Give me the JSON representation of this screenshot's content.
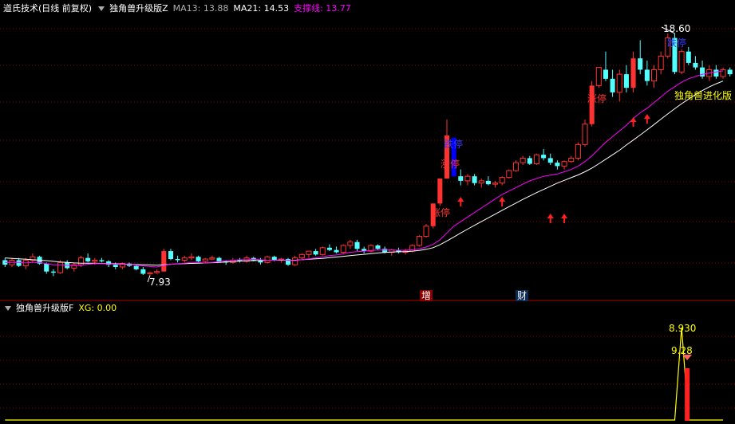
{
  "main_panel": {
    "stock_name": "道氏技术",
    "period": "(日线 前复权)",
    "indicator_name": "独角兽升级版Z",
    "ma13_label": "MA13: 13.88",
    "ma21_label": "MA21: 14.53",
    "support_label": "支撑线: 13.77",
    "high_label": "18.60",
    "low_label": "7.93",
    "annotation_limit_up_1": "涨停",
    "annotation_limit_up_2": "涨停",
    "annotation_limit_up_3": "涨停",
    "annotation_limit_down_1": "跌停",
    "annotation_limit_down_2": "跌停",
    "annotation_evolution": "独角兽进化版",
    "event_increase": "增",
    "event_finance": "财"
  },
  "sub_panel": {
    "indicator_name": "独角兽升级版F",
    "xg_label": "XG: 0.00",
    "peak_label": "8.930",
    "second_label": "9.28"
  },
  "colors": {
    "up": "#ff3232",
    "down": "#54ffff",
    "limit_down": "#0000ff",
    "ma13": "#ff00ff",
    "ma21": "#ffffff",
    "support": "#ffff00",
    "grid": "#8b0000",
    "xg_line": "#ffff00"
  },
  "chart_data": [
    {
      "type": "candlestick",
      "title": "道氏技术 (日线 前复权)",
      "series_labels": [
        "MA13",
        "MA21",
        "支撑线"
      ],
      "ylim": [
        7,
        19.3
      ],
      "candles": [
        [
          8.6,
          8.7,
          8.3,
          8.4
        ],
        [
          8.4,
          8.7,
          8.3,
          8.6
        ],
        [
          8.6,
          8.7,
          8.3,
          8.35
        ],
        [
          8.35,
          8.7,
          8.2,
          8.6
        ],
        [
          8.6,
          8.9,
          8.5,
          8.75
        ],
        [
          8.75,
          8.8,
          8.4,
          8.45
        ],
        [
          8.45,
          8.5,
          8.0,
          8.1
        ],
        [
          8.1,
          8.2,
          7.9,
          8.05
        ],
        [
          8.05,
          8.6,
          8.0,
          8.5
        ],
        [
          8.5,
          8.6,
          8.2,
          8.25
        ],
        [
          8.25,
          8.5,
          8.1,
          8.4
        ],
        [
          8.4,
          8.8,
          8.3,
          8.7
        ],
        [
          8.7,
          8.9,
          8.5,
          8.55
        ],
        [
          8.55,
          8.7,
          8.4,
          8.6
        ],
        [
          8.6,
          8.7,
          8.5,
          8.55
        ],
        [
          8.55,
          8.6,
          8.3,
          8.4
        ],
        [
          8.4,
          8.5,
          8.2,
          8.3
        ],
        [
          8.3,
          8.5,
          8.2,
          8.45
        ],
        [
          8.45,
          8.5,
          8.3,
          8.35
        ],
        [
          8.35,
          8.4,
          8.15,
          8.2
        ],
        [
          8.2,
          8.3,
          7.95,
          8.0
        ],
        [
          8.0,
          8.1,
          7.93,
          8.05
        ],
        [
          8.05,
          8.2,
          8.0,
          8.1
        ],
        [
          8.1,
          9.1,
          8.1,
          9.0
        ],
        [
          9.0,
          9.1,
          8.6,
          8.65
        ],
        [
          8.65,
          8.8,
          8.5,
          8.6
        ],
        [
          8.6,
          8.8,
          8.5,
          8.7
        ],
        [
          8.7,
          8.9,
          8.6,
          8.75
        ],
        [
          8.75,
          8.8,
          8.5,
          8.55
        ],
        [
          8.55,
          8.7,
          8.5,
          8.65
        ],
        [
          8.65,
          8.8,
          8.6,
          8.7
        ],
        [
          8.7,
          8.75,
          8.5,
          8.55
        ],
        [
          8.55,
          8.6,
          8.4,
          8.5
        ],
        [
          8.5,
          8.7,
          8.45,
          8.6
        ],
        [
          8.6,
          8.7,
          8.5,
          8.55
        ],
        [
          8.55,
          8.8,
          8.5,
          8.7
        ],
        [
          8.7,
          8.75,
          8.55,
          8.6
        ],
        [
          8.6,
          8.7,
          8.4,
          8.5
        ],
        [
          8.5,
          8.8,
          8.45,
          8.75
        ],
        [
          8.75,
          8.8,
          8.55,
          8.6
        ],
        [
          8.6,
          8.7,
          8.5,
          8.65
        ],
        [
          8.65,
          8.7,
          8.35,
          8.4
        ],
        [
          8.4,
          8.8,
          8.35,
          8.7
        ],
        [
          8.7,
          8.9,
          8.6,
          8.85
        ],
        [
          8.85,
          9.0,
          8.7,
          9.0
        ],
        [
          9.0,
          9.1,
          8.8,
          8.85
        ],
        [
          8.85,
          9.2,
          8.8,
          9.15
        ],
        [
          9.15,
          9.3,
          9.0,
          9.05
        ],
        [
          9.05,
          9.2,
          8.9,
          8.95
        ],
        [
          8.95,
          9.3,
          8.9,
          9.25
        ],
        [
          9.25,
          9.5,
          9.1,
          9.4
        ],
        [
          9.4,
          9.5,
          9.0,
          9.1
        ],
        [
          9.1,
          9.2,
          8.9,
          9.0
        ],
        [
          9.0,
          9.3,
          8.95,
          9.25
        ],
        [
          9.25,
          9.3,
          9.05,
          9.1
        ],
        [
          9.1,
          9.2,
          8.9,
          8.95
        ],
        [
          8.95,
          9.1,
          8.8,
          9.05
        ],
        [
          9.05,
          9.15,
          8.9,
          8.95
        ],
        [
          8.95,
          9.1,
          8.85,
          9.0
        ],
        [
          9.0,
          9.3,
          8.95,
          9.25
        ],
        [
          9.25,
          9.7,
          9.2,
          9.65
        ],
        [
          9.65,
          10.2,
          9.6,
          10.1
        ],
        [
          10.1,
          11.1,
          10.0,
          11.1
        ],
        [
          11.1,
          12.2,
          11.0,
          12.2
        ],
        [
          12.2,
          14.8,
          12.2,
          14.1
        ],
        [
          14.0,
          14.0,
          12.3,
          12.3
        ],
        [
          12.3,
          12.6,
          11.9,
          12.1
        ],
        [
          12.1,
          12.4,
          11.9,
          12.3
        ],
        [
          12.3,
          12.4,
          11.9,
          12.0
        ],
        [
          12.0,
          12.2,
          11.8,
          12.1
        ],
        [
          12.1,
          12.3,
          11.9,
          11.95
        ],
        [
          11.95,
          12.1,
          11.8,
          12.0
        ],
        [
          12.0,
          12.3,
          11.9,
          12.25
        ],
        [
          12.25,
          12.6,
          12.2,
          12.55
        ],
        [
          12.55,
          13.0,
          12.5,
          12.9
        ],
        [
          12.9,
          13.2,
          12.8,
          13.1
        ],
        [
          13.1,
          13.2,
          12.8,
          12.85
        ],
        [
          12.85,
          13.3,
          12.8,
          13.25
        ],
        [
          13.25,
          13.5,
          13.0,
          13.1
        ],
        [
          13.1,
          13.3,
          12.8,
          12.9
        ],
        [
          12.9,
          13.0,
          12.6,
          12.75
        ],
        [
          12.75,
          13.0,
          12.6,
          12.95
        ],
        [
          12.95,
          13.2,
          12.9,
          13.1
        ],
        [
          13.1,
          13.8,
          13.0,
          13.7
        ],
        [
          13.7,
          14.8,
          13.6,
          14.6
        ],
        [
          14.6,
          16.5,
          14.5,
          16.3
        ],
        [
          16.3,
          17.1,
          16.2,
          17.1
        ],
        [
          17.0,
          17.8,
          16.5,
          16.6
        ],
        [
          16.6,
          17.0,
          15.8,
          16.0
        ],
        [
          16.0,
          17.0,
          15.6,
          16.8
        ],
        [
          16.8,
          17.2,
          16.0,
          16.2
        ],
        [
          16.2,
          17.8,
          16.0,
          17.5
        ],
        [
          17.5,
          18.3,
          16.8,
          17.0
        ],
        [
          17.0,
          17.4,
          16.3,
          16.5
        ],
        [
          16.5,
          17.2,
          16.2,
          17.0
        ],
        [
          17.0,
          17.8,
          16.8,
          17.6
        ],
        [
          17.6,
          18.6,
          17.5,
          18.4
        ],
        [
          18.4,
          18.6,
          16.8,
          16.9
        ],
        [
          16.9,
          17.9,
          16.8,
          17.8
        ],
        [
          17.8,
          18.0,
          17.2,
          17.3
        ],
        [
          17.3,
          17.6,
          17.0,
          17.1
        ],
        [
          17.1,
          17.4,
          16.6,
          16.7
        ],
        [
          16.7,
          17.2,
          16.5,
          17.0
        ],
        [
          17.0,
          17.2,
          16.6,
          16.7
        ],
        [
          16.7,
          17.1,
          16.6,
          17.0
        ],
        [
          17.0,
          17.1,
          16.7,
          16.8
        ]
      ],
      "ma13": [
        8.5,
        8.5,
        8.5,
        8.48,
        8.5,
        8.5,
        8.45,
        8.4,
        8.4,
        8.38,
        8.36,
        8.38,
        8.42,
        8.45,
        8.45,
        8.44,
        8.42,
        8.42,
        8.41,
        8.39,
        8.35,
        8.32,
        8.3,
        8.37,
        8.42,
        8.45,
        8.47,
        8.5,
        8.5,
        8.48,
        8.5,
        8.54,
        8.58,
        8.6,
        8.62,
        8.62,
        8.64,
        8.62,
        8.6,
        8.6,
        8.62,
        8.6,
        8.58,
        8.62,
        8.66,
        8.7,
        8.75,
        8.8,
        8.83,
        8.88,
        8.95,
        8.98,
        9.0,
        9.03,
        9.05,
        9.05,
        9.05,
        9.04,
        9.04,
        9.06,
        9.1,
        9.18,
        9.3,
        9.5,
        9.8,
        10.1,
        10.3,
        10.5,
        10.7,
        10.9,
        11.1,
        11.3,
        11.5,
        11.65,
        11.8,
        11.95,
        12.1,
        12.2,
        12.3,
        12.35,
        12.4,
        12.5,
        12.6,
        12.75,
        12.95,
        13.2,
        13.5,
        13.8,
        14.05,
        14.3,
        14.55,
        14.85,
        15.1,
        15.3,
        15.55,
        15.8,
        16.05,
        16.25,
        16.45,
        16.6,
        16.7,
        16.8,
        16.85,
        16.9,
        16.95
      ],
      "ma21": [
        8.7,
        8.68,
        8.66,
        8.64,
        8.62,
        8.6,
        8.58,
        8.55,
        8.52,
        8.5,
        8.48,
        8.47,
        8.47,
        8.47,
        8.46,
        8.45,
        8.44,
        8.43,
        8.42,
        8.41,
        8.4,
        8.39,
        8.38,
        8.4,
        8.42,
        8.44,
        8.45,
        8.46,
        8.47,
        8.48,
        8.49,
        8.5,
        8.52,
        8.54,
        8.56,
        8.57,
        8.58,
        8.59,
        8.6,
        8.6,
        8.6,
        8.6,
        8.6,
        8.62,
        8.64,
        8.66,
        8.68,
        8.71,
        8.74,
        8.77,
        8.8,
        8.83,
        8.86,
        8.89,
        8.92,
        8.94,
        8.96,
        8.97,
        8.98,
        9.0,
        9.03,
        9.08,
        9.15,
        9.28,
        9.45,
        9.62,
        9.8,
        9.97,
        10.14,
        10.3,
        10.47,
        10.63,
        10.8,
        10.96,
        11.12,
        11.28,
        11.43,
        11.58,
        11.72,
        11.86,
        12.0,
        12.12,
        12.24,
        12.36,
        12.5,
        12.66,
        12.85,
        13.05,
        13.25,
        13.45,
        13.68,
        13.9,
        14.12,
        14.35,
        14.58,
        14.82,
        15.05,
        15.28,
        15.5,
        15.7,
        15.9,
        16.08,
        16.24,
        16.38,
        16.5
      ]
    },
    {
      "type": "line",
      "title": "独角兽升级版F",
      "series_labels": [
        "XG"
      ],
      "ylim": [
        0,
        10
      ],
      "values": [
        0,
        0,
        0,
        0,
        0,
        0,
        0,
        0,
        0,
        0,
        0,
        0,
        0,
        0,
        0,
        0,
        0,
        0,
        0,
        0,
        0,
        0,
        0,
        0,
        0,
        0,
        0,
        0,
        0,
        0,
        0,
        0,
        0,
        0,
        0,
        0,
        0,
        0,
        0,
        0,
        0,
        0,
        0,
        0,
        0,
        0,
        0,
        0,
        0,
        0,
        0,
        0,
        0,
        0,
        0,
        0,
        0,
        0,
        0,
        0,
        0,
        0,
        0,
        0,
        0,
        0,
        0,
        0,
        0,
        0,
        0,
        0,
        0,
        0,
        0,
        0,
        0,
        0,
        0,
        0,
        0,
        0,
        0,
        0,
        0,
        0,
        0,
        0,
        0,
        0,
        0,
        0,
        0,
        0,
        0,
        0,
        0,
        0,
        8.93,
        0,
        0,
        0,
        0,
        0,
        0
      ]
    }
  ]
}
